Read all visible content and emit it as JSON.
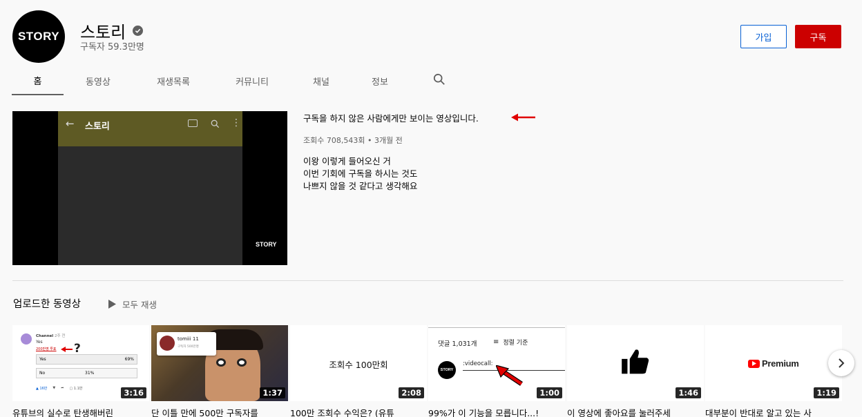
{
  "channel": {
    "avatar_text": "STORY",
    "name": "스토리",
    "subscribers": "구독자 59.3만명",
    "join_label": "가입",
    "subscribe_label": "구독"
  },
  "tabs": [
    {
      "label": "홈",
      "active": true
    },
    {
      "label": "동영상"
    },
    {
      "label": "재생목록"
    },
    {
      "label": "커뮤니티"
    },
    {
      "label": "채널"
    },
    {
      "label": "정보"
    }
  ],
  "featured": {
    "thumb_app_title": "스토리",
    "thumb_watermark": "STORY",
    "title": "구독을 하지 않은 사람에게만 보이는 영상입니다.",
    "meta": "조회수 708,543회 • 3개월 전",
    "description": [
      "이왕 이렇게 들어오신 거",
      "이번 기회에 구독을 하시는 것도",
      "나쁘지 않을 것 같다고 생각해요"
    ]
  },
  "uploads": {
    "section_title": "업로드한 동영상",
    "play_all_label": "모두 재생",
    "videos": [
      {
        "title": "유튜브의 실수로 탄생해버린",
        "duration": "3:16",
        "thumb": {
          "channel": "Channel",
          "age": "2주 전",
          "question": "Yes",
          "link": "200만명 투표",
          "opt1": "Yes",
          "pct1": "69%",
          "opt2": "No",
          "pct2": "31%",
          "likes": "16만",
          "comments": "1.1만"
        }
      },
      {
        "title": "단 이틀 만에 500만 구독자를",
        "duration": "1:37",
        "thumb": {
          "name": "tomiii 11",
          "sub": "구독자 500만명"
        }
      },
      {
        "title": "100만 조회수 수익은? (유튜",
        "duration": "2:08",
        "thumb": {
          "text": "조회수 100만회"
        }
      },
      {
        "title": "99%가 이 기능을 모릅니다...!",
        "duration": "1:00",
        "thumb": {
          "comments": "댓글 1,031개",
          "sort": "정렬 기준",
          "avatar": "STORY",
          "typed": ":videocall:"
        }
      },
      {
        "title": "이 영상에 좋아요를 눌러주세",
        "duration": "1:46",
        "thumb": {}
      },
      {
        "title": "대부분이 반대로 알고 있는 사",
        "duration": "1:19",
        "thumb": {
          "brand": "Premium"
        }
      }
    ]
  },
  "colors": {
    "subscribe": "#cc0000",
    "join_border": "#065fd4",
    "arrow": "#e00000"
  }
}
